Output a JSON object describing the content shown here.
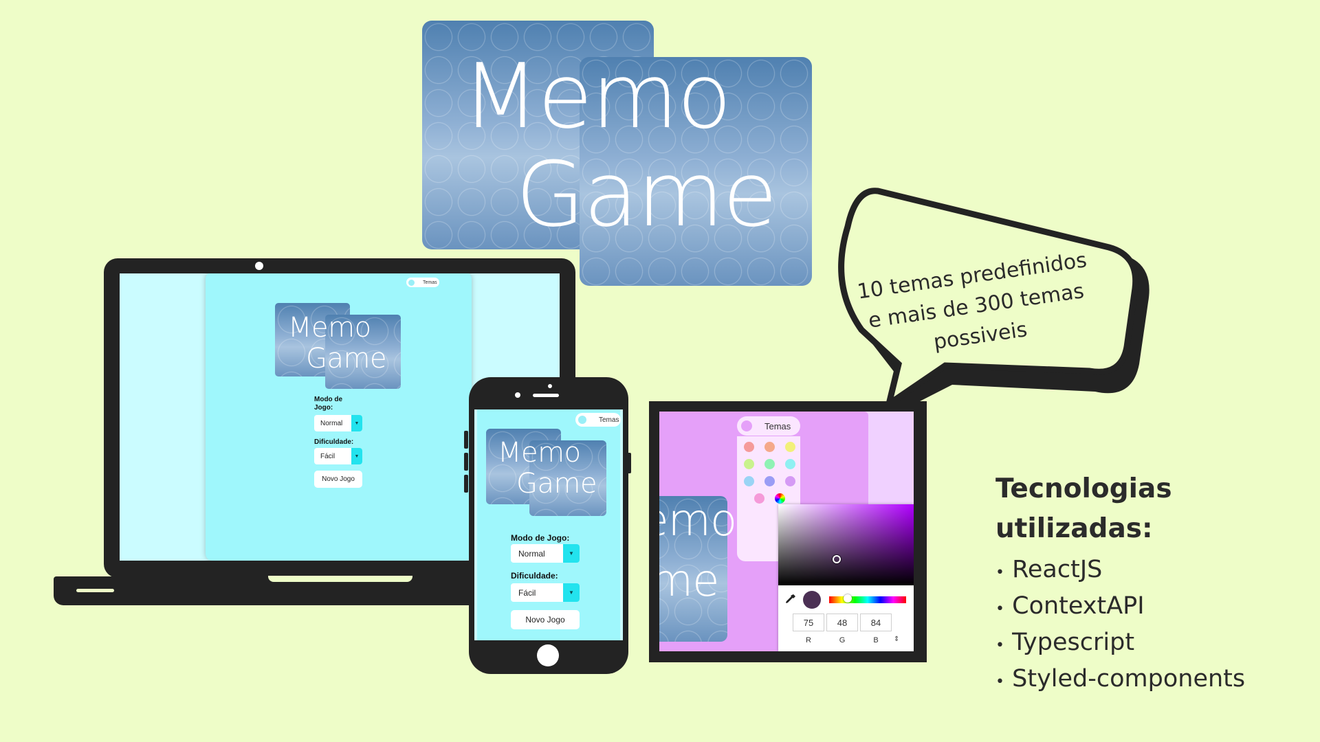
{
  "logo": {
    "line1": "Memo",
    "line2": "Game"
  },
  "bubble": {
    "line1": "10 temas predefinidos",
    "line2": "e mais de 300 temas",
    "line3": "possiveis"
  },
  "tech": {
    "title_line1": "Tecnologias",
    "title_line2": "utilizadas:",
    "items": [
      "ReactJS",
      "ContextAPI",
      "Typescript",
      "Styled-components"
    ],
    "bullet": "•"
  },
  "app": {
    "theme_toggle": "Temas",
    "mode_label": "Modo de Jogo:",
    "mode_value": "Normal",
    "difficulty_label": "Dificuldade:",
    "difficulty_value": "Fácil",
    "new_game": "Novo Jogo"
  },
  "picker": {
    "r": "75",
    "g": "48",
    "b": "84",
    "r_label": "R",
    "g_label": "G",
    "b_label": "B",
    "swatches": [
      "#f59a9a",
      "#f5a98a",
      "#f2f07a",
      "#c9f28d",
      "#8ff2b4",
      "#8ff0f2",
      "#9ad4f5",
      "#9a9cf5",
      "#d59af5",
      "#f59ad9"
    ],
    "selected_color": "#4b3054"
  },
  "colors": {
    "background": "#eefdc8",
    "app_cyan": "#9ff7fc",
    "app_magenta": "#e5a0f9",
    "device_dark": "#232323"
  }
}
